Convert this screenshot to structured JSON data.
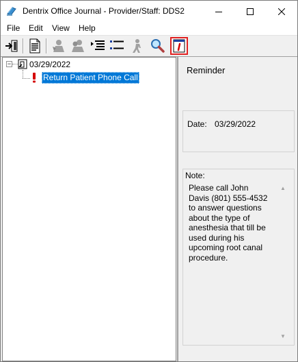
{
  "window": {
    "title": "Dentrix Office Journal - Provider/Staff: DDS2",
    "icon": "dentrix-journal-icon"
  },
  "menu": {
    "items": [
      "File",
      "Edit",
      "View",
      "Help"
    ]
  },
  "toolbar": {
    "buttons": [
      {
        "name": "exit-icon"
      },
      {
        "name": "document-icon"
      },
      {
        "name": "patient-gray-icon"
      },
      {
        "name": "patients-gray-icon"
      },
      {
        "name": "expand-list-icon"
      },
      {
        "name": "collapse-list-icon"
      },
      {
        "name": "walking-person-icon"
      },
      {
        "name": "magnifier-icon"
      },
      {
        "name": "info-icon",
        "active": true
      }
    ],
    "active_outline_color": "#e02020"
  },
  "tree": {
    "root": {
      "label": "03/29/2022",
      "expanded": true,
      "icon": "calendar-door-icon"
    },
    "child": {
      "label": "Return Patient Phone Call",
      "icon": "exclamation-icon",
      "selected": true
    }
  },
  "detail": {
    "title": "Reminder",
    "date_label": "Date:",
    "date_value": "03/29/2022",
    "note_label": "Note:",
    "note_text": "Please call John\nDavis (801) 555-4532\nto answer questions\nabout the type of\nanesthesia that till be\nused during his\nupcoming root canal\nprocedure."
  },
  "colors": {
    "selection": "#0078d7",
    "alert": "#d40000"
  }
}
